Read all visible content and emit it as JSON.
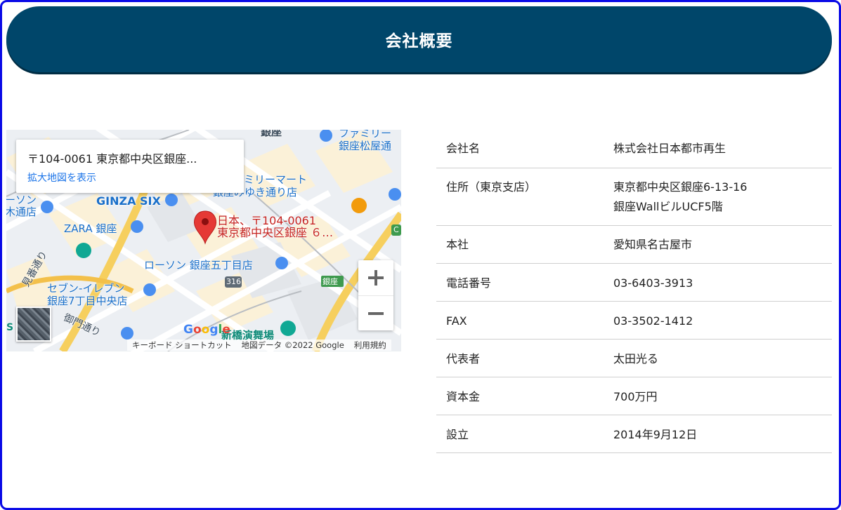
{
  "header": {
    "title": "会社概要"
  },
  "map": {
    "card": {
      "address": "〒104-0061 東京都中央区銀座...",
      "link": "拡大地図を表示"
    },
    "pin_label_line1": "日本、〒104-0061",
    "pin_label_line2": "東京都中央区銀座 ６…",
    "places": {
      "ginza_six": "GINZA SIX",
      "zara": "ZARA 銀座",
      "lawson": "ローソン 銀座五丁目店",
      "seven_line1": "セブン-イレブン",
      "seven_line2": "銀座7丁目中央店",
      "family_line1": "ファミリー",
      "family_line2": "銀座松屋通",
      "family2_line1": "ミリーマート",
      "family2_line2": "銀座みゆき通り店",
      "lawson_left_line1": "ーソン",
      "lawson_left_line2": "木通店",
      "ginza_top": "銀座",
      "ginza_station": "銀座",
      "shinbashi": "新橋演舞場",
      "mihara": "見番通り",
      "onari": "御門通り",
      "route": "316",
      "edge_c": "C",
      "edge_s": "S"
    },
    "google_logo": "Google",
    "attribution": {
      "shortcuts": "キーボード ショートカット",
      "data": "地図データ ©2022 Google",
      "terms": "利用規約"
    },
    "zoom_in": "+",
    "zoom_out": "−"
  },
  "company": {
    "rows": [
      {
        "key": "会社名",
        "value": "株式会社日本都市再生",
        "value2": ""
      },
      {
        "key": "住所（東京支店）",
        "value": "東京都中央区銀座6-13-16",
        "value2": "銀座WallビルUCF5階"
      },
      {
        "key": "本社",
        "value": "愛知県名古屋市",
        "value2": ""
      },
      {
        "key": "電話番号",
        "value": "03-6403-3913",
        "value2": ""
      },
      {
        "key": "FAX",
        "value": "03-3502-1412",
        "value2": ""
      },
      {
        "key": "代表者",
        "value": "太田光る",
        "value2": ""
      },
      {
        "key": "資本金",
        "value": "700万円",
        "value2": ""
      },
      {
        "key": "設立",
        "value": "2014年9月12日",
        "value2": ""
      }
    ]
  },
  "colors": {
    "header_bg": "#00466a",
    "frame_border": "#0a0ae6",
    "link": "#1a73e8",
    "pin": "#e53935"
  }
}
